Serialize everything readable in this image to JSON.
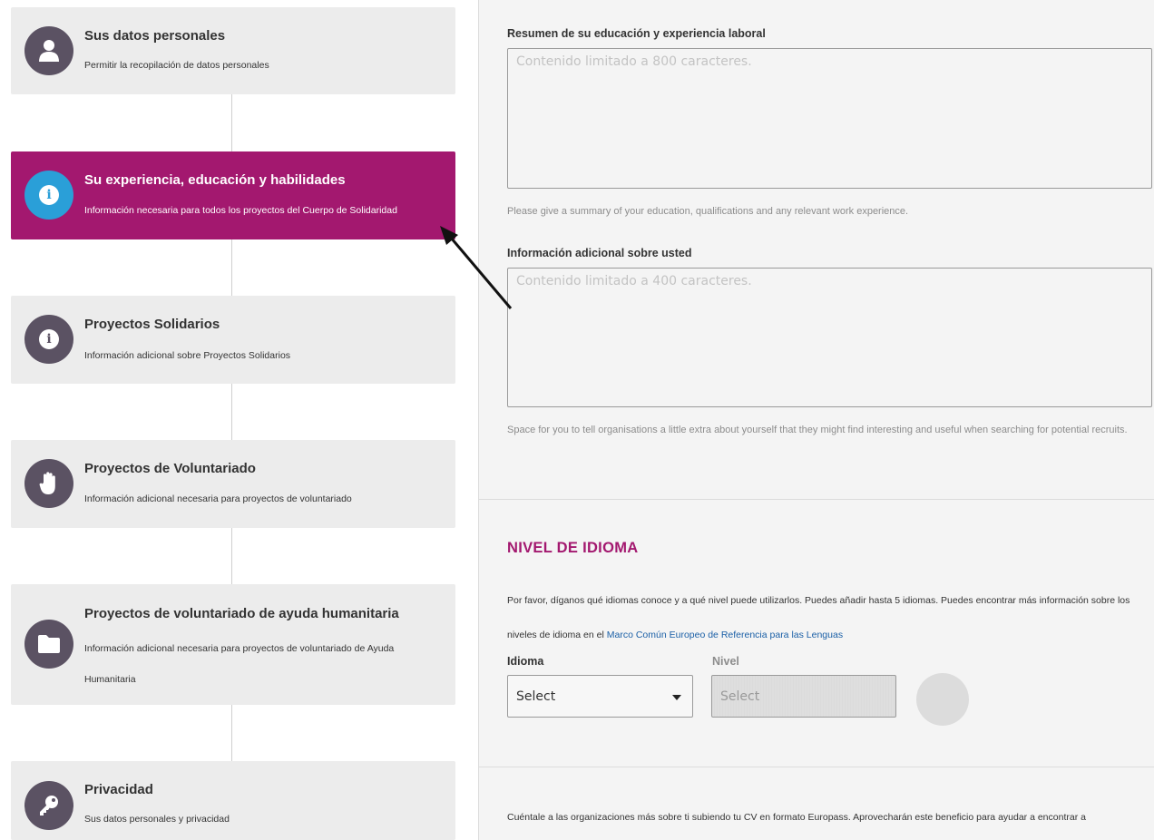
{
  "steps": [
    {
      "title": "Sus datos personales",
      "desc": "Permitir la recopilación de datos personales",
      "icon": "user-icon",
      "active": false
    },
    {
      "title": "Su experiencia, educación y habilidades",
      "desc": "Información necesaria para todos los proyectos del Cuerpo de Solidaridad",
      "icon": "info-icon",
      "active": true
    },
    {
      "title": "Proyectos Solidarios",
      "desc": "Información adicional sobre Proyectos Solidarios",
      "icon": "info-icon",
      "active": false
    },
    {
      "title": "Proyectos de Voluntariado",
      "desc": "Información adicional necesaria para proyectos de voluntariado",
      "icon": "hand-icon",
      "active": false
    },
    {
      "title": "Proyectos de voluntariado de ayuda humanitaria",
      "desc": "Información adicional necesaria para proyectos de voluntariado de Ayuda Humanitaria",
      "icon": "folder-icon",
      "active": false
    },
    {
      "title": "Privacidad",
      "desc": "Sus datos personales y privacidad",
      "icon": "key-icon",
      "active": false
    }
  ],
  "form": {
    "summary": {
      "label": "Resumen de su educación y experiencia laboral",
      "placeholder": "Contenido limitado a 800 caracteres.",
      "help": "Please give a summary of your education, qualifications and any relevant work experience."
    },
    "additional": {
      "label": "Información adicional sobre usted",
      "placeholder": "Contenido limitado a 400 caracteres.",
      "help": "Space for you to tell organisations a little extra about yourself that they might find interesting and useful when searching for potential recruits."
    }
  },
  "language": {
    "section_title": "NIVEL DE IDIOMA",
    "intro": "Por favor, díganos qué idiomas conoce y a qué nivel puede utilizarlos. Puedes añadir hasta 5 idiomas. Puedes encontrar más información sobre los niveles de idioma en el",
    "link": "Marco Común Europeo de Referencia para las Lenguas",
    "language_label": "Idioma",
    "level_label": "Nivel",
    "language_select": "Select",
    "level_select": "Select"
  },
  "europass": {
    "text": "Cuéntale a las organizaciones más sobre ti subiendo tu CV en formato Europass. Aprovecharán este beneficio para ayudar a encontrar a"
  },
  "colors": {
    "accent": "#a3186f",
    "active_icon": "#2a9fd8",
    "icon_bg": "#5b5263",
    "link": "#1a5fa6"
  }
}
